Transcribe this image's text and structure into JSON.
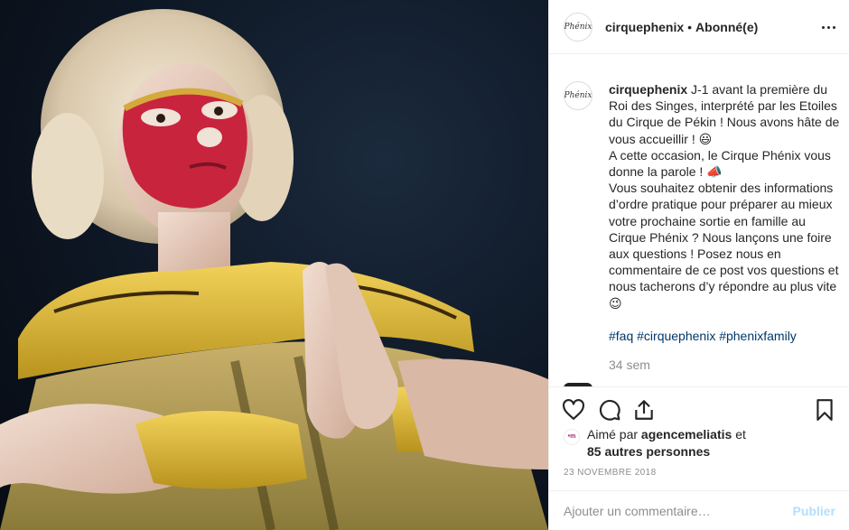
{
  "post": {
    "image_alt": "Artiste du Roi des Singes, maquillage rouge et costume doré, mains jointes"
  },
  "header": {
    "avatar_text": "Phénix",
    "username": "cirquephenix",
    "separator": "•",
    "follow_status": "Abonné(e)",
    "more_icon": "more-horizontal-icon"
  },
  "caption": {
    "avatar_text": "Phénix",
    "username": "cirquephenix",
    "lines": [
      "J-1 avant la première du Roi des Singes, interprété par les Etoiles du Cirque de Pékin ! Nous avons hâte de vous accueillir ! 😃",
      "A cette occasion, le Cirque Phénix vous donne la parole ! 📣",
      "Vous souhaitez obtenir des informations d’ordre pratique pour préparer au mieux votre prochaine sortie en famille au Cirque Phénix ? Nous lançons une foire aux questions ! Posez nous en commentaire de ce post vos questions et nous tacherons d’y répondre au plus vite 😉"
    ],
    "hashtags": [
      "#faq",
      "#cirquephenix",
      "#phenixfamily"
    ],
    "time_ago": "34 sem"
  },
  "actions": {
    "like_icon": "heart-icon",
    "comment_icon": "comment-icon",
    "share_icon": "share-icon",
    "save_icon": "bookmark-icon"
  },
  "likes": {
    "avatar_text": "•m",
    "prefix": "Aimé par ",
    "user": "agencemeliatis",
    "suffix": " et",
    "others": "85 autres personnes"
  },
  "date": "23 NOVEMBRE 2018",
  "comment": {
    "placeholder": "Ajouter un commentaire…",
    "publish_label": "Publier"
  },
  "colors": {
    "text": "#262626",
    "muted": "#8e8e8e",
    "link": "#00376b",
    "publish_disabled": "#b2dffc",
    "border": "#efefef"
  }
}
